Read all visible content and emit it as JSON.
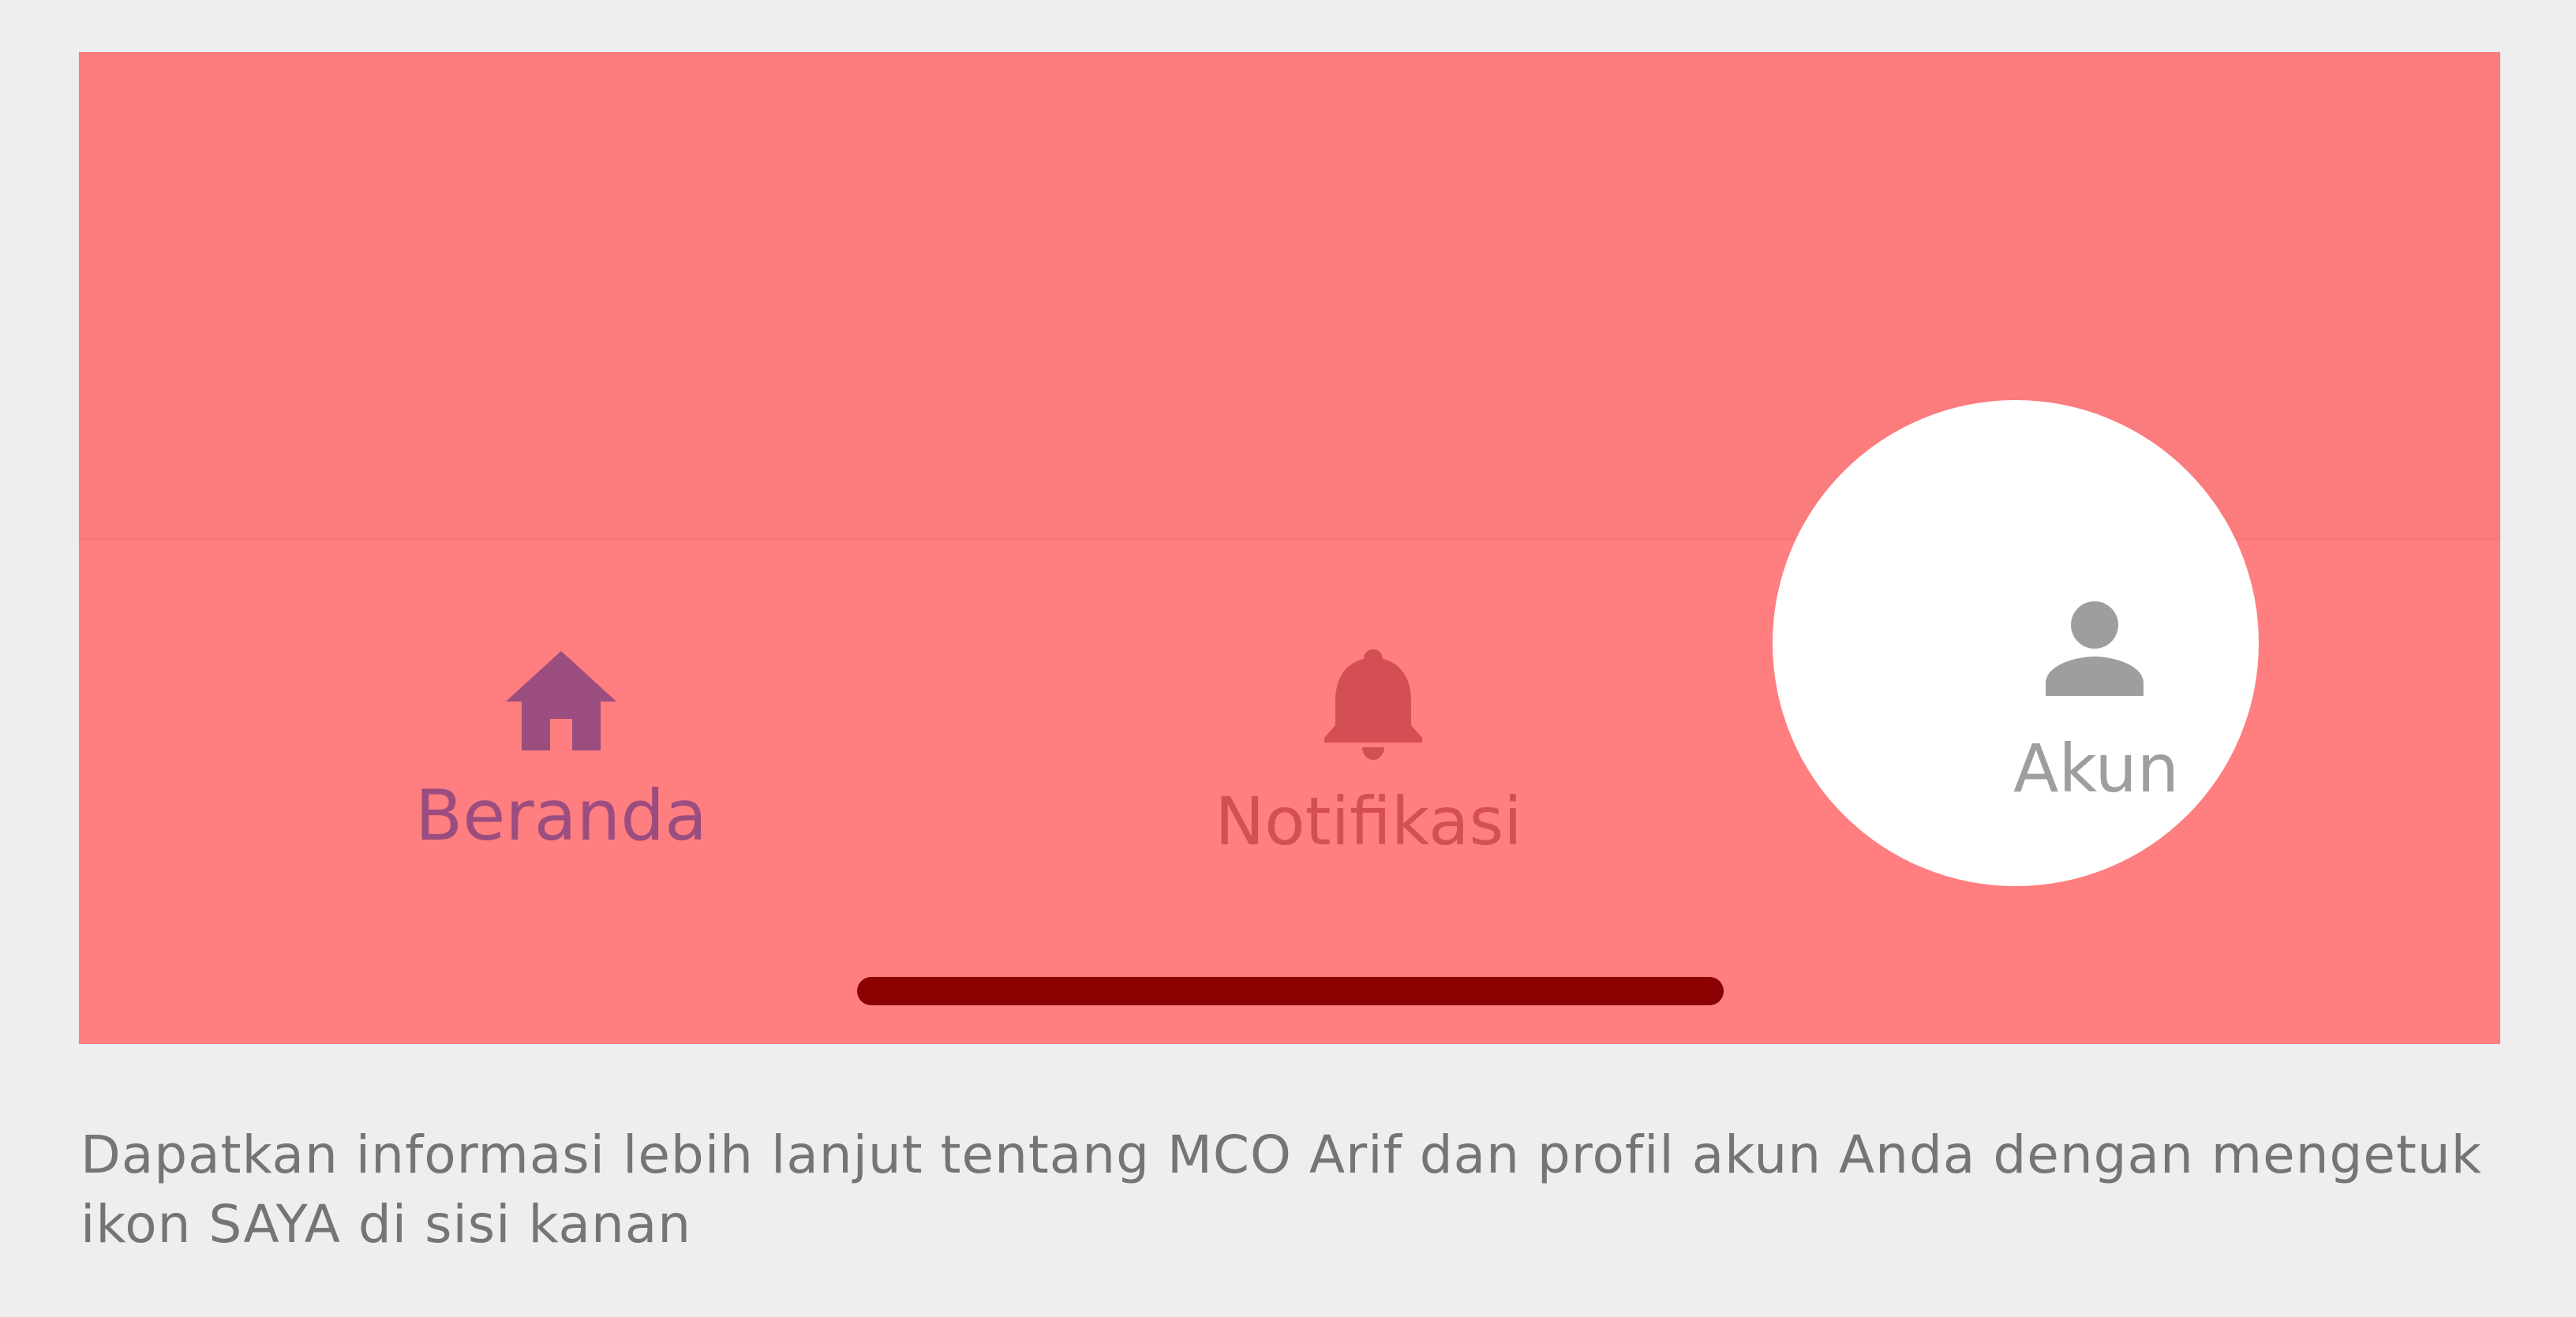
{
  "tab_bar": {
    "tabs": [
      {
        "label": "Beranda",
        "icon": "home-icon",
        "color": "#9b4d7f",
        "state": "active"
      },
      {
        "label": "Notifikasi",
        "icon": "bell-icon",
        "color": "#d44f53",
        "state": "inactive"
      },
      {
        "label": "Akun",
        "icon": "person-icon",
        "color": "#9e9e9e",
        "state": "highlighted"
      }
    ]
  },
  "caption": {
    "text": "Dapatkan informasi lebih lanjut tentang MCO Arif dan profil akun Anda dengan mengetuk ikon SAYA di sisi kanan"
  },
  "colors": {
    "overlay": "#fc7d7e",
    "spotlight": "#ffffff",
    "home_indicator": "#8b0000",
    "page_background": "#eeeeee"
  }
}
